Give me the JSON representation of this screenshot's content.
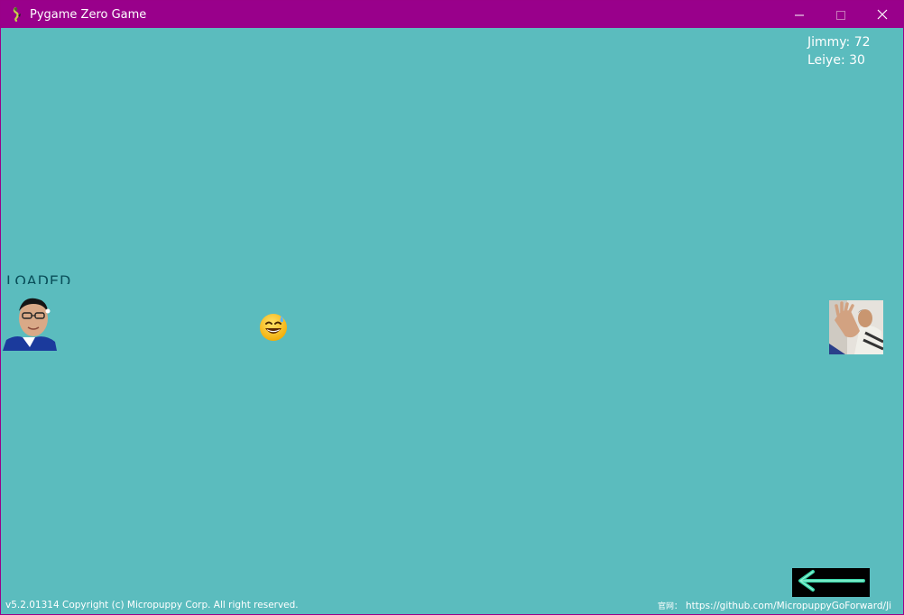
{
  "window": {
    "title": "Pygame Zero Game",
    "titlebar_color": "#99008b",
    "background_color": "#5bbcbe"
  },
  "icons": {
    "app": "pygame-snake-icon",
    "minimize": "minimize-icon",
    "maximize": "maximize-icon",
    "close": "close-icon",
    "ball": "grinning-sweat-emoji-icon",
    "back": "left-arrow-icon"
  },
  "scores": [
    {
      "name": "Jimmy",
      "value": 72,
      "text": "Jimmy: 72"
    },
    {
      "name": "Leiye",
      "value": 30,
      "text": "Leiye: 30"
    }
  ],
  "left_player": {
    "status_label": "LOADED"
  },
  "footer": {
    "copyright": "v5.2.01314 Copyright (c) Micropuppy Corp. All right reserved.",
    "site_label": "官网：",
    "site_url": "https://github.com/MicropuppyGoForward/Ji"
  },
  "colors": {
    "score_text": "#ffffff",
    "back_arrow": "#39d4a8",
    "back_button_bg": "#000000"
  }
}
